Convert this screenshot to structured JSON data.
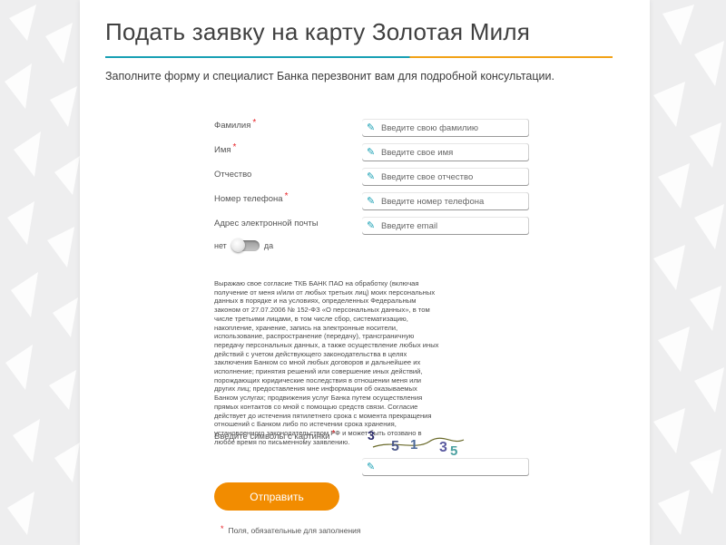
{
  "header": {
    "title": "Подать заявку на карту Золотая Миля",
    "subtitle": "Заполните форму и специалист Банка перезвонит вам для подробной консультации."
  },
  "form": {
    "fields": [
      {
        "label": "Фамилия",
        "required_mark": "*",
        "placeholder": "Введите свою фамилию"
      },
      {
        "label": "Имя",
        "required_mark": "*",
        "placeholder": "Введите свое имя"
      },
      {
        "label": "Отчество",
        "required_mark": "",
        "placeholder": "Введите свое отчество"
      },
      {
        "label": "Номер телефона",
        "required_mark": "*",
        "placeholder": "Введите номер телефона"
      },
      {
        "label": "Адрес электронной почты",
        "required_mark": "",
        "placeholder": "Введите email"
      }
    ],
    "consent_toggle": {
      "off_label": "нет",
      "on_label": "да",
      "checked": false
    },
    "consent_text": "Выражаю свое согласие ТКБ БАНК ПАО на обработку (включая получение от меня и/или от любых третьих лиц) моих персональных данных в порядке и на условиях, определенных Федеральным законом от 27.07.2006 № 152-ФЗ «О персональных данных», в том числе третьими лицами, в том числе сбор, систематизацию, накопление, хранение, запись на электронные носители, использование, распространение (передачу), трансграничную передачу персональных данных, а также осуществление любых иных действий с учетом действующего законодательства в целях заключения Банком со мной любых договоров и дальнейшее их исполнение; принятия решений или совершение иных действий, порождающих юридические последствия в отношении меня или других лиц; предоставления мне информации об оказываемых Банком услугах; продвижения услуг Банка путем осуществления прямых контактов со мной с помощью средств связи. Согласие действует до истечения пятилетнего срока с момента прекращения отношений с Банком либо по истечении срока хранения, установленного законодательством РФ и может быть отозвано в любое время по письменному заявлению.",
    "captcha": {
      "label": "Введите символы с картинки",
      "required_mark": "*",
      "chars": [
        "3",
        "5",
        "1",
        "3",
        "5"
      ],
      "input_value": ""
    },
    "submit_label": "Отправить",
    "footnote_mark": "*",
    "footnote_text": "Поля, обязательные для заполнения"
  },
  "colors": {
    "accent_teal": "#18a0b4",
    "accent_orange": "#f2a217",
    "button_orange": "#f28c00",
    "required_red": "#e8262b"
  },
  "icons": {
    "input_icon": "pencil-icon"
  }
}
